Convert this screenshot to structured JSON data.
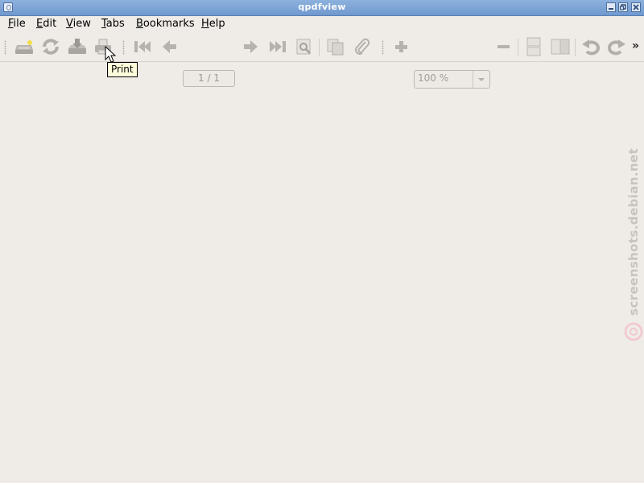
{
  "window": {
    "title": "qpdfview"
  },
  "menubar": {
    "items": [
      {
        "accel": "F",
        "rest": "ile"
      },
      {
        "accel": "E",
        "rest": "dit"
      },
      {
        "accel": "V",
        "rest": "iew"
      },
      {
        "accel": "T",
        "rest": "abs"
      },
      {
        "accel": "B",
        "rest": "ookmarks"
      },
      {
        "accel": "H",
        "rest": "elp"
      }
    ]
  },
  "toolbar": {
    "page_display": "1 / 1",
    "zoom_value": "100 %",
    "overflow_label": "»",
    "icons": [
      "open-icon",
      "refresh-icon",
      "save-icon",
      "print-icon",
      "first-page-icon",
      "previous-page-icon",
      "next-page-icon",
      "last-page-icon",
      "search-icon",
      "copy-icon",
      "attachment-icon",
      "zoom-in-icon",
      "zoom-out-icon",
      "continuous-mode-icon",
      "two-pages-icon",
      "rotate-left-icon",
      "rotate-right-icon"
    ]
  },
  "tooltip": {
    "text": "Print"
  },
  "watermark": {
    "text": "screenshots.debian.net"
  },
  "colors": {
    "titlebar": "#7aa3d6",
    "background": "#efebe7",
    "tooltip_bg": "#ffffdc"
  }
}
